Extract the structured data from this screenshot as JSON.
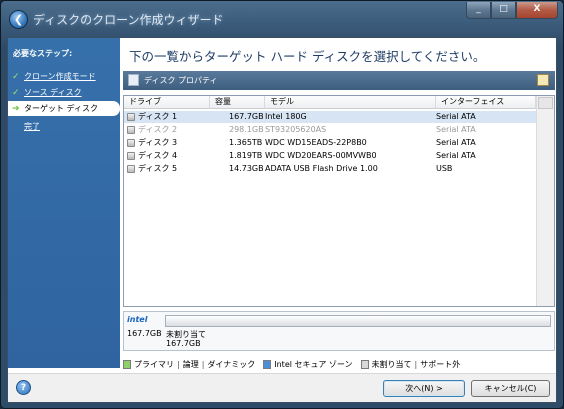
{
  "window": {
    "title": "ディスクのクローン作成ウィザード",
    "back_icon": "back-arrow-icon",
    "minimize": "_",
    "restore": "□",
    "close": "X"
  },
  "sidebar": {
    "heading": "必要なステップ:",
    "items": [
      {
        "label": "クローン作成モード",
        "icon": "check-icon",
        "glyph": "✓"
      },
      {
        "label": "ソース ディスク",
        "icon": "check-icon",
        "glyph": "✓"
      },
      {
        "label": "ターゲット ディスク",
        "icon": "arrow-icon",
        "glyph": "➔",
        "active": true
      },
      {
        "label": "完了",
        "icon": "",
        "glyph": ""
      }
    ]
  },
  "main": {
    "title": "下の一覧からターゲット ハード ディスクを選択してください。",
    "props_label": "ディスク プロパティ"
  },
  "table": {
    "columns": [
      "ドライブ",
      "容量",
      "モデル",
      "インターフェイス"
    ],
    "rows": [
      {
        "drive": "ディスク 1",
        "capacity": "167.7GB",
        "model": "Intel 180G",
        "interface": "Serial ATA",
        "state": "selected"
      },
      {
        "drive": "ディスク 2",
        "capacity": "298.1GB",
        "model": "ST93205620AS",
        "interface": "Serial ATA",
        "state": "disabled"
      },
      {
        "drive": "ディスク 3",
        "capacity": "1.365TB",
        "model": "WDC WD15EADS-22P8B0",
        "interface": "Serial ATA",
        "state": "normal"
      },
      {
        "drive": "ディスク 4",
        "capacity": "1.819TB",
        "model": "WDC WD20EARS-00MVWB0",
        "interface": "Serial ATA",
        "state": "normal"
      },
      {
        "drive": "ディスク 5",
        "capacity": "14.73GB",
        "model": "ADATA USB Flash Drive 1.00",
        "interface": "USB",
        "state": "normal"
      }
    ]
  },
  "disk_map": {
    "brand": "intel",
    "total": "167.7GB",
    "label1": "未割り当て",
    "label2": "167.7GB"
  },
  "legend": {
    "primary": "プライマリ",
    "logical": "論理",
    "dynamic": "ダイナミック",
    "intel_secure": "Intel セキュア ゾーン",
    "unallocated": "未割り当て",
    "unsupported": "サポート外",
    "colors": {
      "primary": "#8ed06a",
      "intel_secure": "#4a90d9",
      "unallocated": "#d9d9d9"
    }
  },
  "footer": {
    "help": "?",
    "next": "次へ(N) >",
    "cancel": "キャンセル(C)"
  }
}
